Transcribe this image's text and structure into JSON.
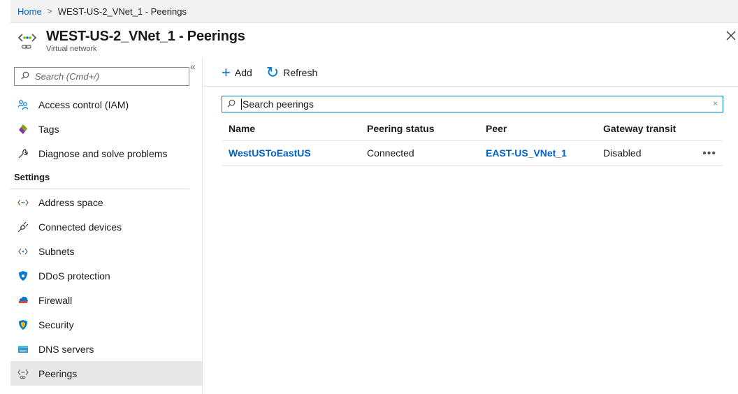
{
  "breadcrumb": {
    "home": "Home",
    "separator": ">",
    "current": "WEST-US-2_VNet_1 - Peerings"
  },
  "blade": {
    "title": "WEST-US-2_VNet_1 - Peerings",
    "subtitle": "Virtual network",
    "close_icon": "close-icon"
  },
  "sidebar": {
    "search_placeholder": "Search (Cmd+/)",
    "collapse_label": "«",
    "items_top": [
      {
        "label": "Access control (IAM)",
        "icon": "people-icon"
      },
      {
        "label": "Tags",
        "icon": "tag-icon"
      },
      {
        "label": "Diagnose and solve problems",
        "icon": "wrench-icon"
      }
    ],
    "settings_header": "Settings",
    "items_settings": [
      {
        "label": "Address space",
        "icon": "vnet-brackets-icon"
      },
      {
        "label": "Connected devices",
        "icon": "plug-icon"
      },
      {
        "label": "Subnets",
        "icon": "subnets-brackets-icon"
      },
      {
        "label": "DDoS protection",
        "icon": "shield-icon"
      },
      {
        "label": "Firewall",
        "icon": "firewall-cloud-icon"
      },
      {
        "label": "Security",
        "icon": "security-shield-icon"
      },
      {
        "label": "DNS servers",
        "icon": "dns-icon"
      },
      {
        "label": "Peerings",
        "icon": "peerings-icon",
        "selected": true
      }
    ]
  },
  "toolbar": {
    "add_label": "Add",
    "add_glyph": "+",
    "refresh_label": "Refresh",
    "refresh_glyph": "↻"
  },
  "filter": {
    "placeholder": "Search peerings",
    "clear_glyph": "×"
  },
  "grid": {
    "columns": [
      "Name",
      "Peering status",
      "Peer",
      "Gateway transit"
    ],
    "rows": [
      {
        "name": "WestUSToEastUS",
        "status": "Connected",
        "peer": "EAST-US_VNet_1",
        "gateway_transit": "Disabled",
        "more": "•••"
      }
    ]
  },
  "colors": {
    "accent": "#0078d4",
    "link": "#0062c4",
    "selected_bg": "#e8e8e8"
  }
}
